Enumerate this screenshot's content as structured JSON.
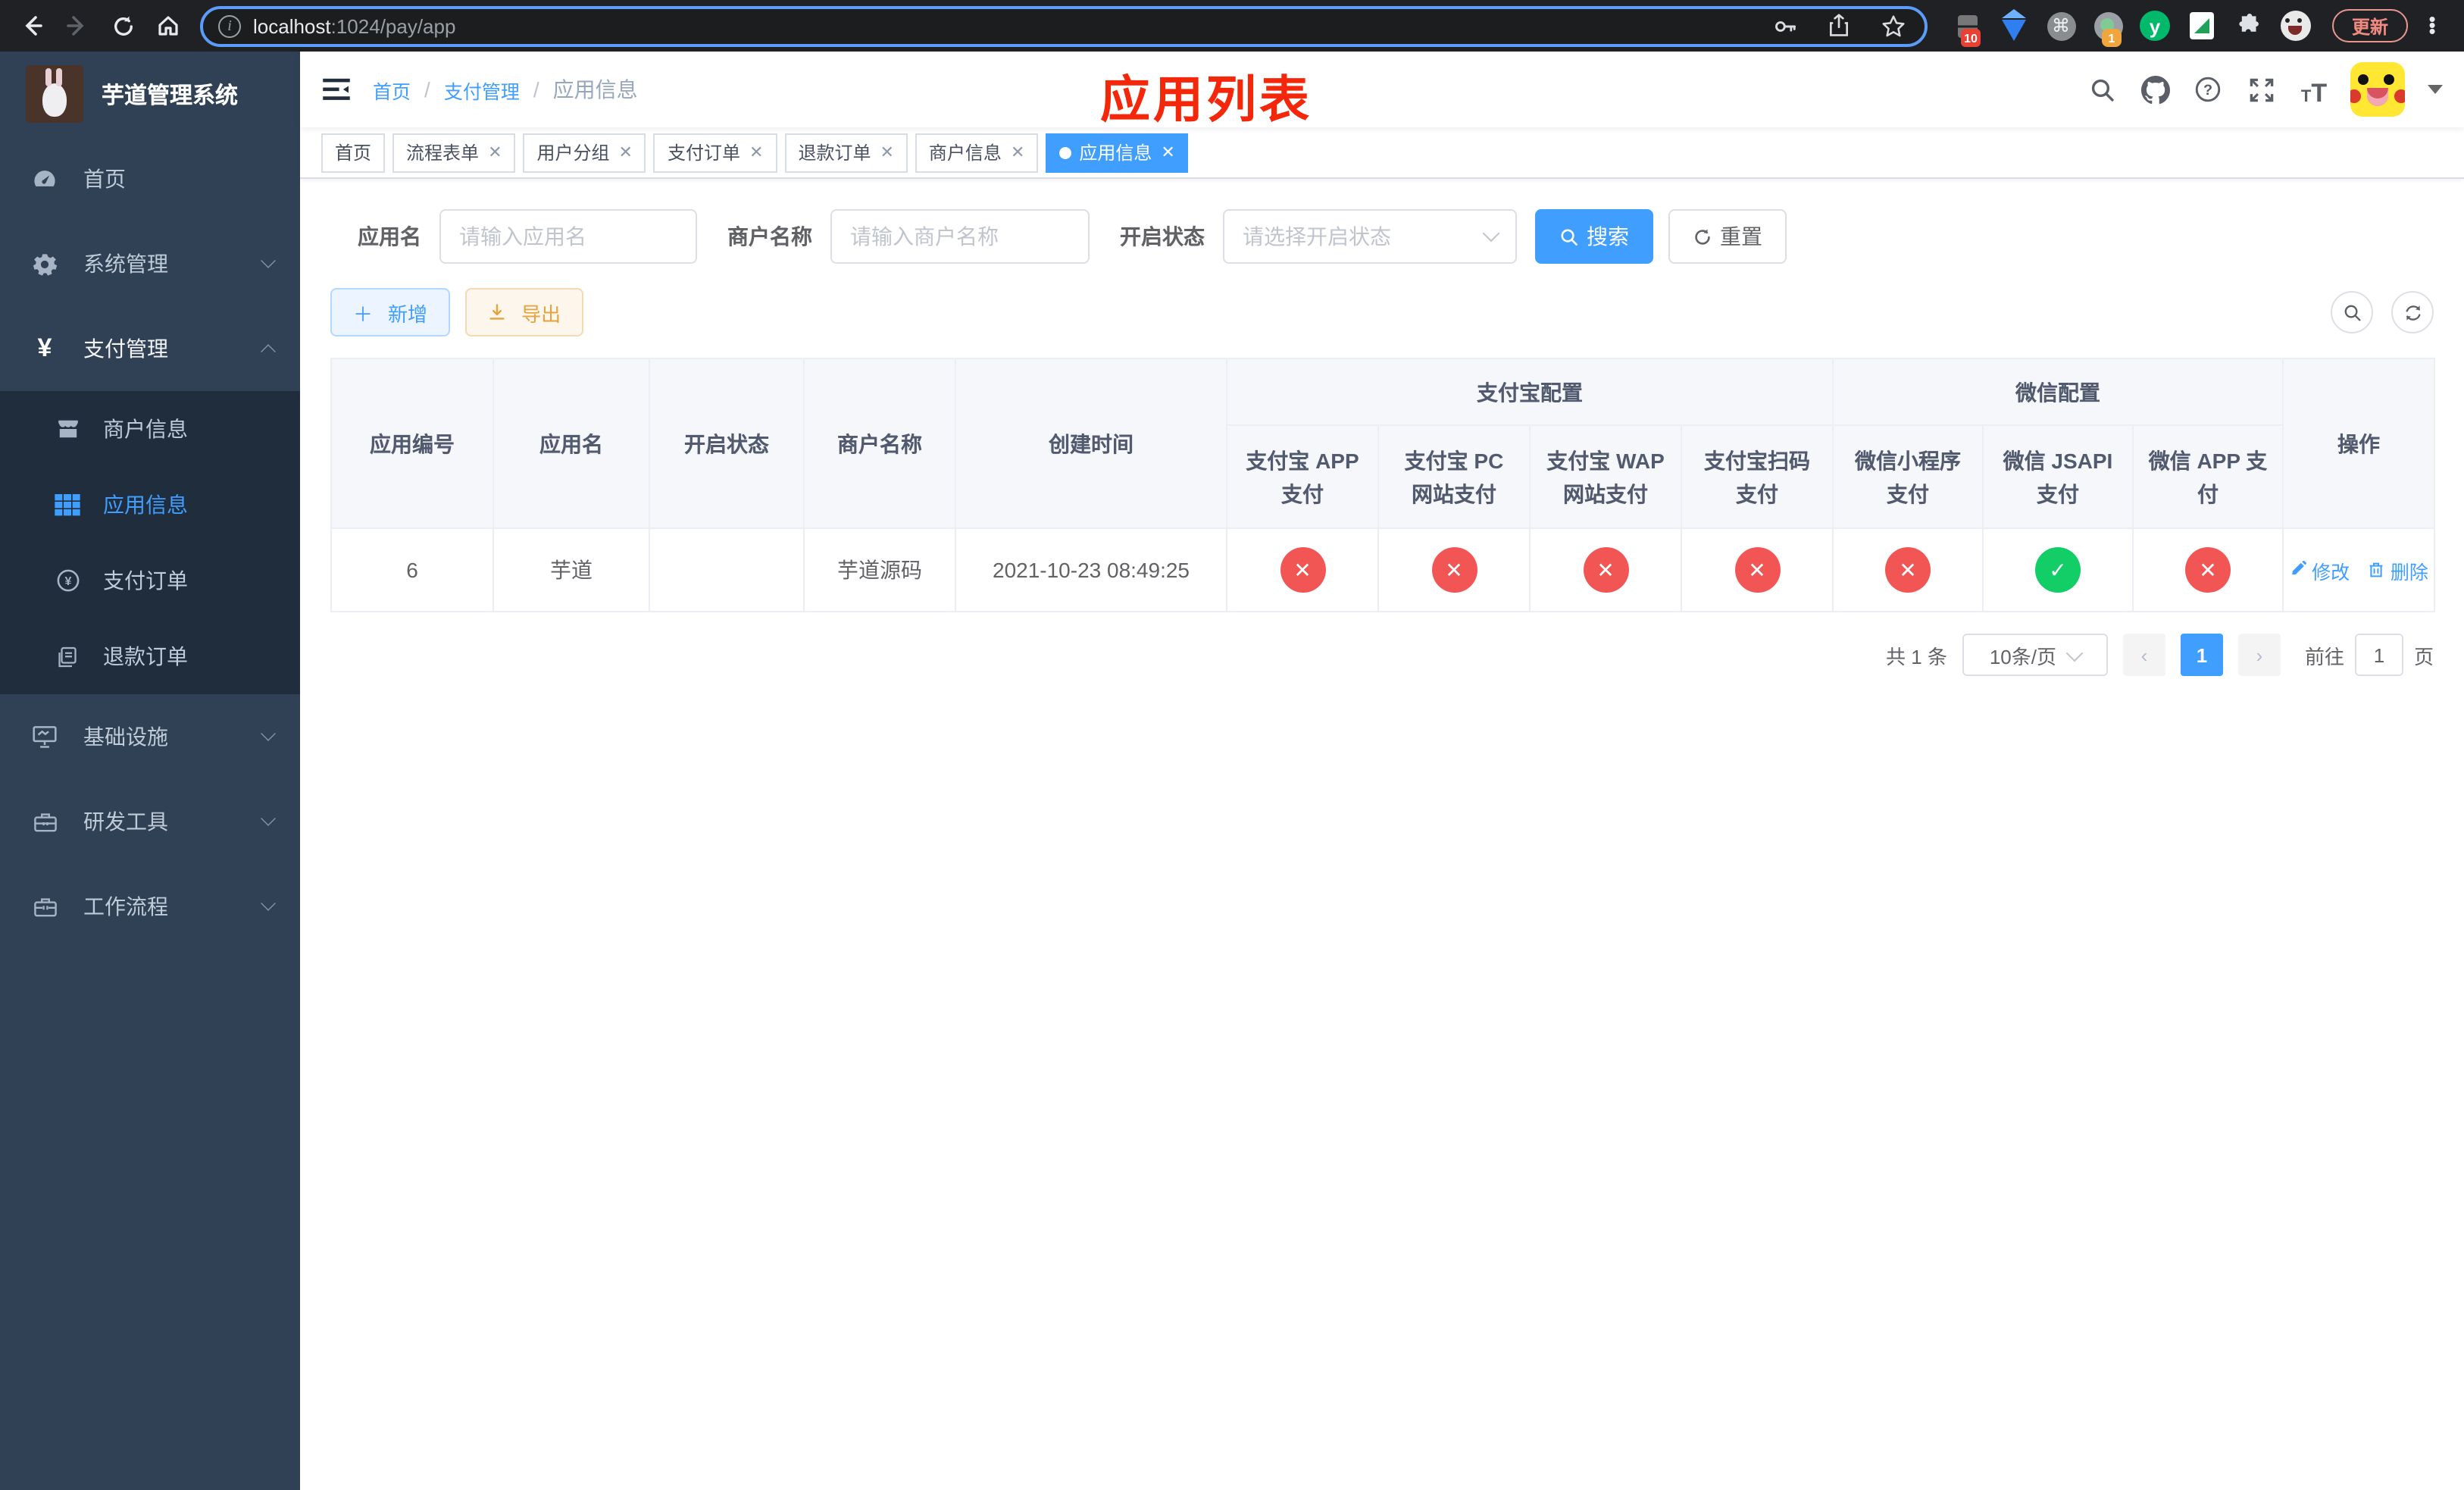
{
  "browser": {
    "url_domain": "localhost",
    "url_path": ":1024/pay/app",
    "update_button": "更新",
    "ext_badge_count_a": "10",
    "ext_badge_count_b": "1",
    "ext_y_label": "y"
  },
  "sidebar": {
    "title": "芋道管理系统",
    "menu": [
      {
        "label": "首页",
        "icon": "dashboard-icon"
      },
      {
        "label": "系统管理",
        "icon": "gear-icon",
        "state": "collapsed"
      },
      {
        "label": "支付管理",
        "icon": "yuan-icon",
        "state": "expanded"
      },
      {
        "label": "基础设施",
        "icon": "monitor-icon",
        "state": "collapsed"
      },
      {
        "label": "研发工具",
        "icon": "toolbox-icon",
        "state": "collapsed"
      },
      {
        "label": "工作流程",
        "icon": "workflow-icon",
        "state": "collapsed"
      }
    ],
    "submenu": [
      {
        "label": "商户信息",
        "icon": "store-icon",
        "active": false
      },
      {
        "label": "应用信息",
        "icon": "grid-icon",
        "active": true
      },
      {
        "label": "支付订单",
        "icon": "pay-order-icon",
        "active": false
      },
      {
        "label": "退款订单",
        "icon": "refund-icon",
        "active": false
      }
    ]
  },
  "navbar": {
    "breadcrumb": {
      "0": "首页",
      "1": "支付管理",
      "2": "应用信息",
      "separator": "/"
    },
    "annotation": "应用列表",
    "annotation_color": "#f5270b"
  },
  "tags": {
    "close_glyph": "✕",
    "items": [
      {
        "label": "首页",
        "closable": false,
        "active": false
      },
      {
        "label": "流程表单",
        "closable": true,
        "active": false
      },
      {
        "label": "用户分组",
        "closable": true,
        "active": false
      },
      {
        "label": "支付订单",
        "closable": true,
        "active": false
      },
      {
        "label": "退款订单",
        "closable": true,
        "active": false
      },
      {
        "label": "商户信息",
        "closable": true,
        "active": false
      },
      {
        "label": "应用信息",
        "closable": true,
        "active": true
      }
    ]
  },
  "search": {
    "app_name_label": "应用名",
    "app_name_placeholder": "请输入应用名",
    "merchant_label": "商户名称",
    "merchant_placeholder": "请输入商户名称",
    "status_label": "开启状态",
    "status_placeholder": "请选择开启状态",
    "search_button": "搜索",
    "reset_button": "重置"
  },
  "toolbar": {
    "add_button": "新增",
    "export_button": "导出"
  },
  "table": {
    "col_app_id": "应用编号",
    "col_app_name": "应用名",
    "col_status": "开启状态",
    "col_merchant": "商户名称",
    "col_created": "创建时间",
    "group_alipay": "支付宝配置",
    "group_wechat": "微信配置",
    "col_alipay_app": "支付宝 APP 支付",
    "col_alipay_pc": "支付宝 PC 网站支付",
    "col_alipay_wap": "支付宝 WAP 网站支付",
    "col_alipay_qr": "支付宝扫码支付",
    "col_wx_mini": "微信小程序支付",
    "col_wx_jsapi": "微信 JSAPI 支付",
    "col_wx_app": "微信 APP 支付",
    "col_actions": "操作",
    "row": {
      "app_id": "6",
      "app_name": "芋道",
      "enabled": true,
      "merchant": "芋道源码",
      "created": "2021-10-23 08:49:25",
      "statuses": [
        "cross",
        "cross",
        "cross",
        "cross",
        "cross",
        "check",
        "cross"
      ],
      "edit_label": "修改",
      "delete_label": "删除"
    }
  },
  "pagination": {
    "total": "共 1 条",
    "page_size": "10条/页",
    "prev_icon": "‹",
    "next_icon": "›",
    "page": "1",
    "goto_label": "前往",
    "goto_value": "1",
    "goto_suffix": "页"
  },
  "colors": {
    "accent": "#409eff",
    "success": "#13ce66",
    "danger": "#f25654",
    "warning": "#e6a23c",
    "sidebar_bg": "#304156",
    "submenu_bg": "#1f2d3d"
  }
}
